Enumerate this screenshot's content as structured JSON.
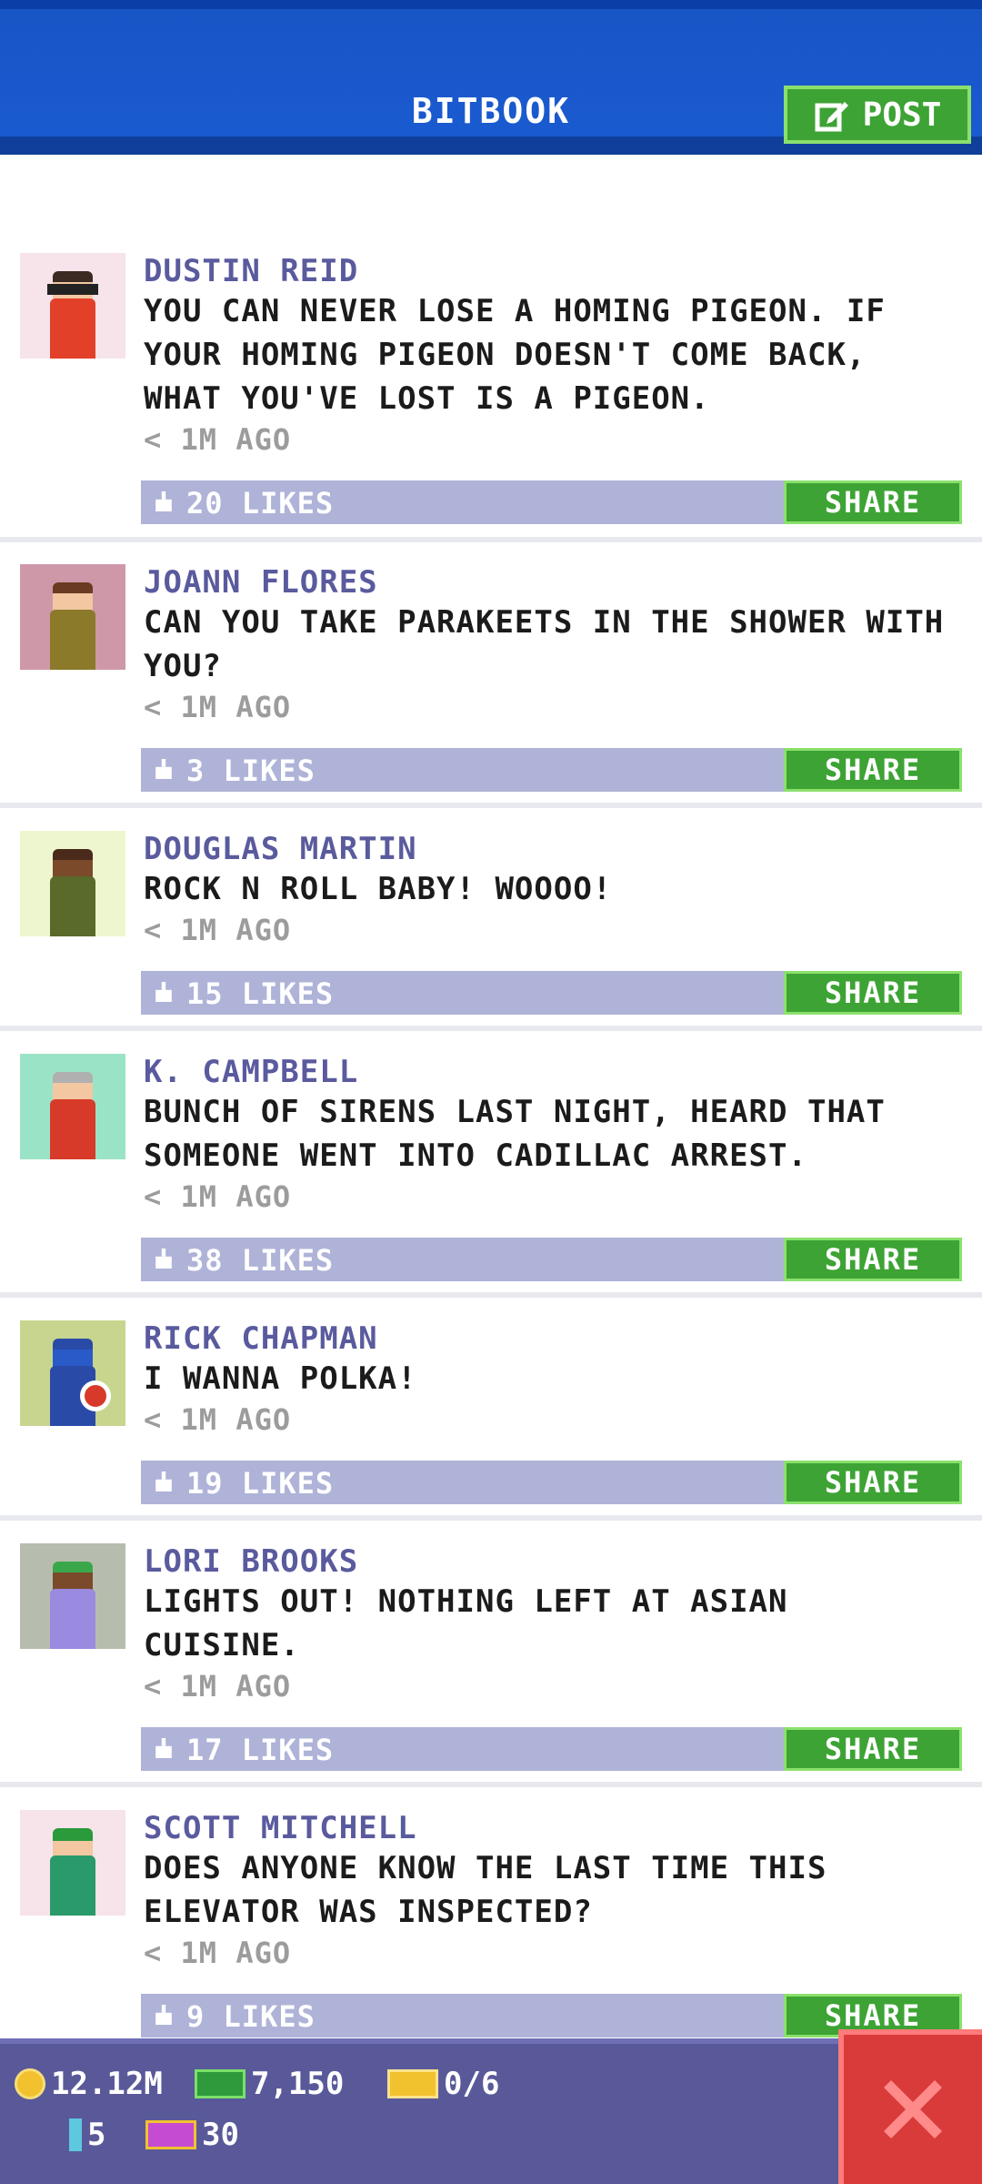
{
  "header": {
    "title": "BITBOOK",
    "post_label": "POST"
  },
  "posts": [
    {
      "name": "DUSTIN REID",
      "text": "YOU CAN NEVER LOSE A HOMING PIGEON. IF YOUR HOMING PIGEON DOESN'T COME BACK, WHAT YOU'VE LOST IS A PIGEON.",
      "time": "< 1M AGO",
      "likes": "20 LIKES",
      "share": "SHARE"
    },
    {
      "name": "JOANN FLORES",
      "text": "CAN YOU TAKE PARAKEETS IN THE SHOWER WITH YOU?",
      "time": "< 1M AGO",
      "likes": "3 LIKES",
      "share": "SHARE"
    },
    {
      "name": "DOUGLAS MARTIN",
      "text": "ROCK N ROLL BABY! WOOOO!",
      "time": "< 1M AGO",
      "likes": "15 LIKES",
      "share": "SHARE"
    },
    {
      "name": "K. CAMPBELL",
      "text": "BUNCH OF SIRENS LAST NIGHT, HEARD THAT SOMEONE WENT INTO CADILLAC ARREST.",
      "time": "< 1M AGO",
      "likes": "38 LIKES",
      "share": "SHARE"
    },
    {
      "name": "RICK CHAPMAN",
      "text": "I WANNA POLKA!",
      "time": "< 1M AGO",
      "likes": "19 LIKES",
      "share": "SHARE"
    },
    {
      "name": "LORI BROOKS",
      "text": "LIGHTS OUT! NOTHING LEFT AT ASIAN CUISINE.",
      "time": "< 1M AGO",
      "likes": "17 LIKES",
      "share": "SHARE"
    },
    {
      "name": "SCOTT MITCHELL",
      "text": "DOES ANYONE KNOW THE LAST TIME THIS ELEVATOR WAS INSPECTED?",
      "time": "< 1M AGO",
      "likes": "9 LIKES",
      "share": "SHARE"
    }
  ],
  "stats": {
    "coins": "12.12M",
    "bux": "7,150",
    "tickets": "0/6",
    "keys": "5",
    "vip": "30"
  },
  "colors": {
    "header_blue": "#1a5ad0",
    "accent_green": "#3da334",
    "likes_bar": "#afb3d8",
    "name_purple": "#5a5a9e",
    "close_red": "#d93a3a",
    "bottom_bar": "#59599a"
  },
  "icons": [
    "edit-icon",
    "like-icon",
    "coin-icon",
    "bux-icon",
    "ticket-icon",
    "key-icon",
    "vip-icon",
    "close-icon"
  ]
}
